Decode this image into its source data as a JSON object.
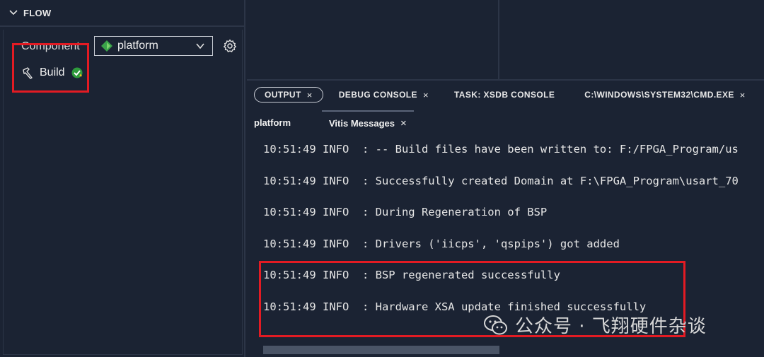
{
  "flow": {
    "title": "FLOW",
    "component_label": "Component",
    "component_value": "platform",
    "build_label": "Build"
  },
  "panel": {
    "tabs": [
      {
        "label": "OUTPUT",
        "close": "×"
      },
      {
        "label": "DEBUG CONSOLE",
        "close": "×"
      },
      {
        "label": "TASK: XSDB CONSOLE",
        "close": ""
      },
      {
        "label": "C:\\WINDOWS\\SYSTEM32\\CMD.EXE",
        "close": "×"
      }
    ],
    "subtabs": [
      {
        "label": "platform"
      },
      {
        "label": "Vitis Messages",
        "close": "×"
      }
    ]
  },
  "log": [
    "10:51:49 INFO  : -- Build files have been written to: F:/FPGA_Program/us",
    "10:51:49 INFO  : Successfully created Domain at F:\\FPGA_Program\\usart_70",
    "10:51:49 INFO  : During Regeneration of BSP",
    "10:51:49 INFO  : Drivers ('iicps', 'qspips') got added",
    "10:51:49 INFO  : BSP regenerated successfully",
    "10:51:49 INFO  : Hardware XSA update finished successfully"
  ],
  "watermark": "公众号 · 飞翔硬件杂谈",
  "colors": {
    "background": "#1b2333",
    "highlight": "#e31b23",
    "platform_icon": "#3aa34a",
    "success_badge": "#2e9a3c"
  },
  "icons": [
    "chevron-down-icon",
    "platform-icon",
    "settings-gear-icon",
    "hammer-icon",
    "success-check-icon",
    "wechat-icon"
  ]
}
